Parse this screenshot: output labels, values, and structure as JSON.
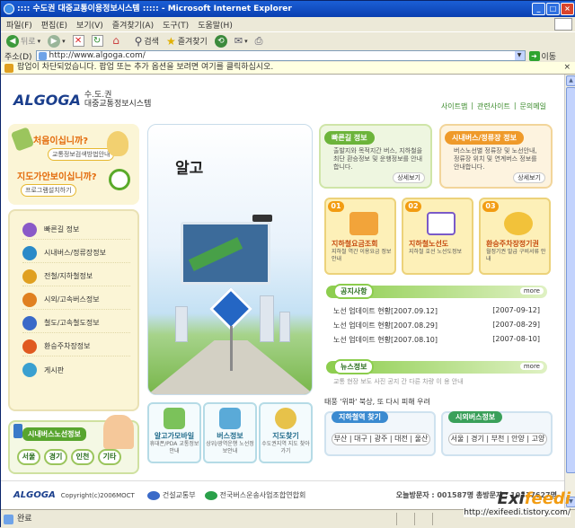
{
  "window": {
    "title": ":::: 수도권 대중교통이용정보시스템 ::::: - Microsoft Internet Explorer",
    "minimize": "_",
    "maximize": "□",
    "close": "×"
  },
  "menubar": [
    "파일(F)",
    "편집(E)",
    "보기(V)",
    "즐겨찾기(A)",
    "도구(T)",
    "도움말(H)"
  ],
  "toolbar": {
    "back": "뒤로",
    "search": "검색",
    "favorites": "즐겨찾기"
  },
  "address": {
    "label": "주소(D)",
    "url": "http://www.algoga.com/",
    "go": "이동"
  },
  "popup_bar": "팝업이 차단되었습니다. 팝업 또는 추가 옵션을 보려면 여기를 클릭하십시오.",
  "site": {
    "logo": "ALGOGA",
    "logo_sub1": "수.도.권",
    "logo_sub2": "대중교통정보시스템",
    "top_links": [
      "사이트맵",
      "관련사이트",
      "문의메일"
    ],
    "first_visit": "처음이십니까?",
    "first_visit_link": "교통정보검색방법안내",
    "map_usage": "지도가안보이십니까?",
    "map_usage_link": "프로그램설치하기",
    "left_menu": [
      "빠른길 정보",
      "시내버스/정류장정보",
      "전철/지하철정보",
      "시외/고속버스정보",
      "철도/고속철도정보",
      "환승주차장정보",
      "게시판"
    ],
    "bus_info": "시내버스노선정보",
    "regions": [
      "서울",
      "경기",
      "인천",
      "기타"
    ],
    "hero_tagline": "알고",
    "quick_links": [
      {
        "title": "알고가모바일",
        "desc": "휴대폰/PDA 교통정보 안내"
      },
      {
        "title": "버스정보",
        "desc": "상위/광역운행 노선정보안내"
      },
      {
        "title": "지도찾기",
        "desc": "수도권지역 지도 찾아가기"
      }
    ],
    "cards": [
      {
        "title": "빠른길 정보",
        "desc": "출발지와 목적지간 버스, 지하철을 최단 환승정보 및 운행정보를 안내합니다.",
        "more": "상세보기"
      },
      {
        "title": "시내버스/정류장 정보",
        "desc": "버스노선별 정류장 및 노선안내, 정류장 위치 및 연계버스 정보를 안내합니다.",
        "more": "상세보기"
      }
    ],
    "features": [
      {
        "num": "01",
        "title": "지하철요금조회",
        "desc": "지하철 역간 이용요금 정보안내"
      },
      {
        "num": "02",
        "title": "지하철노선도",
        "desc": "지하철 호선 노선도정보"
      },
      {
        "num": "03",
        "title": "환승주차장정기권",
        "desc": "월정기권 발급 구비서류 안내"
      }
    ],
    "notice_label": "공지사항",
    "notice_more": "more",
    "notices": [
      {
        "title": "노선 업데이트 현황[2007.09.12]",
        "date": "[2007-09-12]"
      },
      {
        "title": "노선 업데이트 현황[2007.08.29]",
        "date": "[2007-08-29]"
      },
      {
        "title": "노선 업데이트 현황[2007.08.10]",
        "date": "[2007-08-10]"
      }
    ],
    "news_label": "뉴스정보",
    "news_more": "more",
    "news": [
      "교통 현장 보도 사진 공지 간 다른 차량 이 용 안내",
      "태풍 '위파' 북상, 또 다시 피해 우려"
    ],
    "subway_btns_label": "지하철역 찾기",
    "subway_btns": "부산 | 대구 | 광주 | 대전 | 울산",
    "bus_btns_label": "시외버스정보",
    "bus_btns": "서울 | 경기 | 부천 | 안양 | 고양",
    "footer_copyright": "Copyright(c)2006MOCT",
    "footer_org1": "건설교통부",
    "footer_org2": "전국버스운송사업조합연합회",
    "visitors_label": "오늘방문자 : ",
    "visitors_today": "001587",
    "visitors_total_label": "명 총방문자 : ",
    "visitors_total": "10317627",
    "visitors_unit": "명"
  },
  "status": "완료",
  "watermark": {
    "brand_a": "Exi",
    "brand_b": "feedi",
    "url": "http://exifeedi.tistory.com/"
  }
}
